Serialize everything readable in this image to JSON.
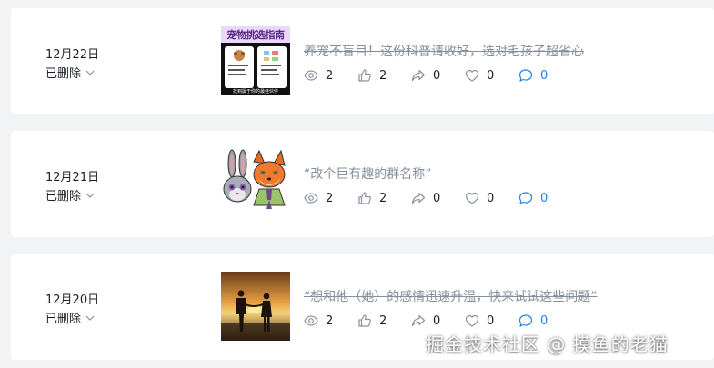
{
  "articles": [
    {
      "date": "12月22日",
      "status": "已删除",
      "thumb_title": "宠物挑选指南",
      "thumb_caption": "找到属于你的最佳伙伴",
      "title": "养宠不盲目！这份科普请收好，选对毛孩子超省心",
      "views": "2",
      "likes": "2",
      "shares": "0",
      "favorites": "0",
      "comments": "0"
    },
    {
      "date": "12月21日",
      "status": "已删除",
      "title": "“改个巨有趣的群名称”",
      "views": "2",
      "likes": "2",
      "shares": "0",
      "favorites": "0",
      "comments": "0"
    },
    {
      "date": "12月20日",
      "status": "已删除",
      "title": "“想和他（她）的感情迅速升温，快来试试这些问题”",
      "views": "2",
      "likes": "2",
      "shares": "0",
      "favorites": "0",
      "comments": "0"
    }
  ],
  "watermark": "掘金技术社区 @ 摸鱼的老猫",
  "colors": {
    "accent": "#1e80ff",
    "muted": "#86909c",
    "text": "#1d2129",
    "background": "#f2f3f5"
  },
  "icons": [
    "eye-icon",
    "thumb-up-icon",
    "share-icon",
    "heart-icon",
    "comment-icon",
    "chevron-down-icon"
  ]
}
